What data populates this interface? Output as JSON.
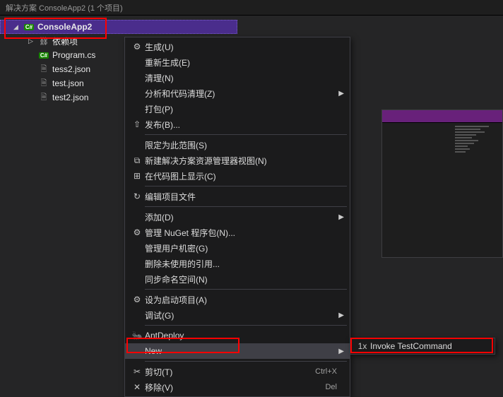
{
  "titleBar": "解决方案 ConsoleApp2 (1 个项目)",
  "tree": {
    "project": "ConsoleApp2",
    "deps": "依赖项",
    "file_cs": "Program.cs",
    "file_tess2": "tess2.json",
    "file_test": "test.json",
    "file_test2": "test2.json"
  },
  "menu": {
    "build": "生成(U)",
    "rebuild": "重新生成(E)",
    "clean": "清理(N)",
    "analyze": "分析和代码清理(Z)",
    "pack": "打包(P)",
    "publish": "发布(B)...",
    "scope": "限定为此范围(S)",
    "newView": "新建解决方案资源管理器视图(N)",
    "codeMap": "在代码图上显示(C)",
    "editProj": "编辑项目文件",
    "add": "添加(D)",
    "nuget": "管理 NuGet 程序包(N)...",
    "userSecrets": "管理用户机密(G)",
    "removeUnused": "删除未使用的引用...",
    "syncNs": "同步命名空间(N)",
    "setStartup": "设为启动项目(A)",
    "debug": "调试(G)",
    "antdeploy": "AntDeploy",
    "new": "New",
    "cut": "剪切(T)",
    "remove": "移除(V)",
    "shortcut_cut": "Ctrl+X",
    "shortcut_del": "Del"
  },
  "submenu": {
    "invoke": "Invoke TestCommand",
    "icon_label": "1x"
  }
}
